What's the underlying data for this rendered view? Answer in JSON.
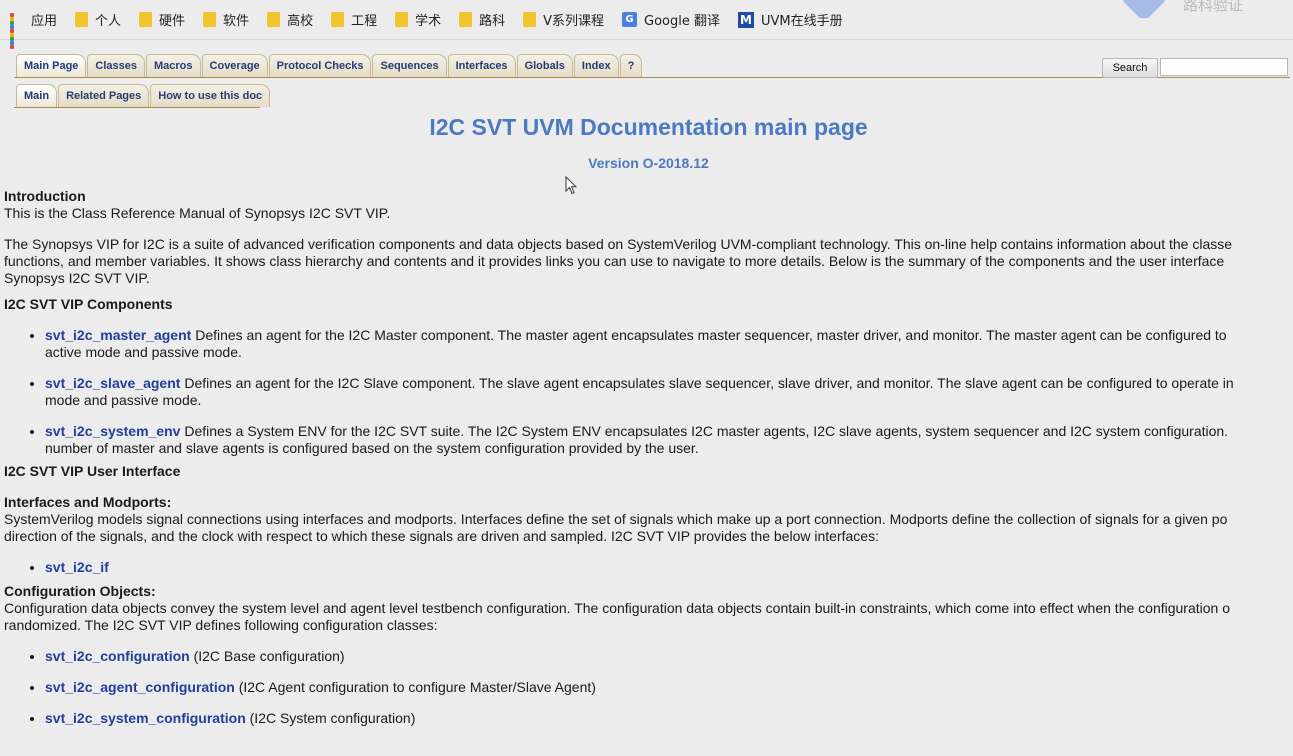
{
  "bookmarks": {
    "items": [
      {
        "label": "应用",
        "icon": "apps-grid-icon"
      },
      {
        "label": "个人",
        "icon": "folder-icon"
      },
      {
        "label": "硬件",
        "icon": "folder-icon"
      },
      {
        "label": "软件",
        "icon": "folder-icon"
      },
      {
        "label": "高校",
        "icon": "folder-icon"
      },
      {
        "label": "工程",
        "icon": "folder-icon"
      },
      {
        "label": "学术",
        "icon": "folder-icon"
      },
      {
        "label": "路科",
        "icon": "folder-icon"
      },
      {
        "label": "V系列课程",
        "icon": "folder-icon"
      },
      {
        "label": "Google 翻译",
        "icon": "google-translate-icon"
      },
      {
        "label": "UVM在线手册",
        "icon": "uvm-icon"
      }
    ]
  },
  "nav": {
    "tabs": [
      "Main Page",
      "Classes",
      "Macros",
      "Coverage",
      "Protocol Checks",
      "Sequences",
      "Interfaces",
      "Globals",
      "Index",
      "?"
    ],
    "subtabs": [
      "Main",
      "Related Pages",
      "How to use this doc"
    ],
    "search_label": "Search",
    "search_value": ""
  },
  "colors": {
    "title": "#4b79c2",
    "link": "#1f3f9a",
    "tab_text": "#263c73",
    "folder": "#f4c430"
  },
  "main": {
    "title": "I2C SVT UVM Documentation main page",
    "version": "Version O-2018.12",
    "intro_heading": "Introduction",
    "intro_text": "This is the Class Reference Manual of Synopsys I2C SVT VIP.",
    "desc_line1": "The Synopsys VIP for I2C is a suite of advanced verification components and data objects based on SystemVerilog UVM-compliant technology. This on-line help contains information about the classe",
    "desc_line2": "functions, and member variables. It shows class hierarchy and contents and it provides links you can use to navigate to more details. Below is the summary of the components and the user interface",
    "desc_line3": "Synopsys I2C SVT VIP.",
    "components_heading": "I2C SVT VIP Components",
    "components": [
      {
        "name": "svt_i2c_master_agent",
        "text": " Defines an agent for the I2C Master component. The master agent encapsulates master sequencer, master driver, and monitor. The master agent can be configured to",
        "text2": "active mode and passive mode."
      },
      {
        "name": "svt_i2c_slave_agent",
        "text": " Defines an agent for the I2C Slave component. The slave agent encapsulates slave sequencer, slave driver, and monitor. The slave agent can be configured to operate in",
        "text2": "mode and passive mode."
      },
      {
        "name": "svt_i2c_system_env",
        "text": " Defines a System ENV for the I2C SVT suite. The I2C System ENV encapsulates I2C master agents, I2C slave agents, system sequencer and I2C system configuration.",
        "text2": "number of master and slave agents is configured based on the system configuration provided by the user."
      }
    ],
    "ui_heading": "I2C SVT VIP User Interface",
    "if_heading": "Interfaces and Modports:",
    "if_line1": "SystemVerilog models signal connections using interfaces and modports. Interfaces define the set of signals which make up a port connection. Modports define the collection of signals for a given po",
    "if_line2": "direction of the signals, and the clock with respect to which these signals are driven and sampled. I2C SVT VIP provides the below interfaces:",
    "interfaces": [
      {
        "name": "svt_i2c_if"
      }
    ],
    "cfg_heading": "Configuration Objects:",
    "cfg_line1": "Configuration data objects convey the system level and agent level testbench configuration. The configuration data objects contain built-in constraints, which come into effect when the configuration o",
    "cfg_line2": "randomized. The I2C SVT VIP defines following configuration classes:",
    "configs": [
      {
        "name": "svt_i2c_configuration",
        "text": " (I2C Base configuration)"
      },
      {
        "name": "svt_i2c_agent_configuration",
        "text": " (I2C Agent configuration to configure Master/Slave Agent)"
      },
      {
        "name": "svt_i2c_system_configuration",
        "text": " (I2C System configuration)"
      }
    ]
  }
}
